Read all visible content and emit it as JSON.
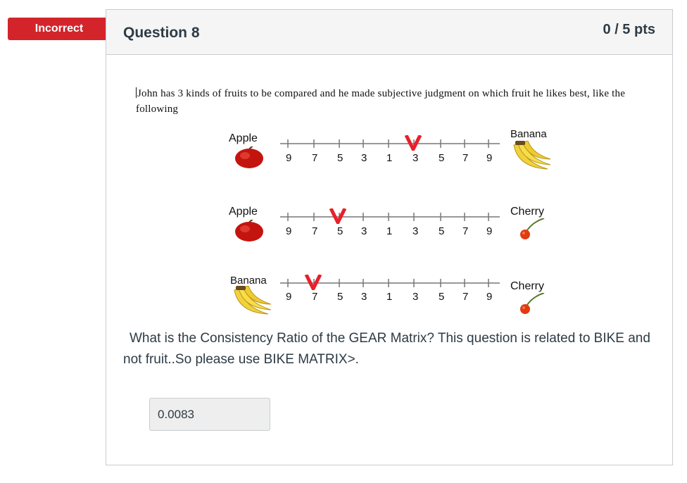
{
  "status": {
    "label": "Incorrect",
    "color": "#d4242b"
  },
  "question": {
    "title": "Question 8",
    "points": "0 / 5 pts",
    "intro": "John has 3 kinds of fruits to be compared and he made subjective judgment on which fruit he likes best, like the following",
    "prompt": "What is the Consistency Ratio of the GEAR Matrix? This question is related to BIKE and not fruit..So please use BIKE MATRIX>."
  },
  "comparisons": [
    {
      "left": "Apple",
      "right": "Banana",
      "left_icon": "apple-icon",
      "right_icon": "banana-icon",
      "marked_index": 5
    },
    {
      "left": "Apple",
      "right": "Cherry",
      "left_icon": "apple-icon",
      "right_icon": "cherry-icon",
      "marked_index": 2
    },
    {
      "left": "Banana",
      "right": "Cherry",
      "left_icon": "banana-icon",
      "right_icon": "cherry-icon",
      "marked_index": 1
    }
  ],
  "scale_labels": [
    "9",
    "7",
    "5",
    "3",
    "1",
    "3",
    "5",
    "7",
    "9"
  ],
  "answer": {
    "value": "0.0083"
  },
  "colors": {
    "marker": "#e8202a",
    "text": "#2d3b45",
    "header_bg": "#f5f5f5"
  }
}
